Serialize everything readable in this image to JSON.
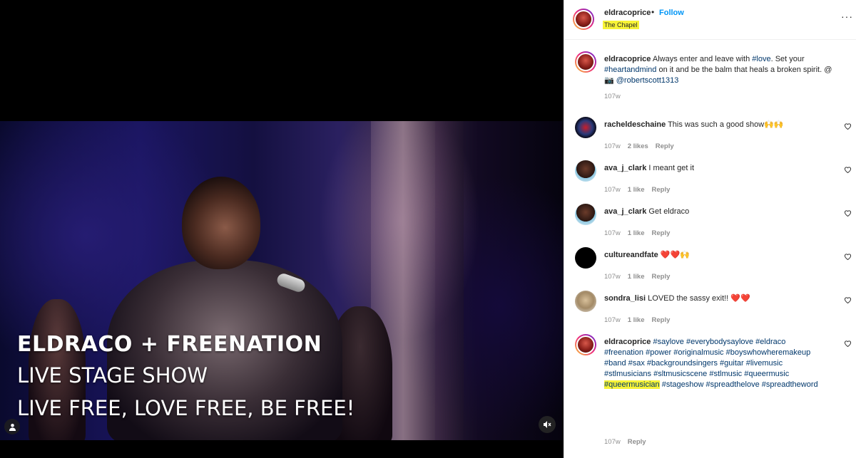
{
  "media": {
    "overlay_lines": [
      "ELDRACO + FREENATION",
      "LIVE STAGE SHOW",
      "LIVE FREE, LOVE FREE, BE FREE!"
    ],
    "user_tag_icon": "person-icon",
    "mute_icon": "muted-speaker-icon"
  },
  "header": {
    "username": "eldracoprice",
    "separator": "•",
    "follow": "Follow",
    "location": "The Chapel",
    "more": "···"
  },
  "caption": {
    "username": "eldracoprice",
    "text_parts": [
      "Always enter and leave with ",
      "#love",
      ". Set your ",
      "#heartandmind",
      " on it and be the balm that heals a broken spirit. @",
      "📷",
      " ",
      "@robertscott1313"
    ],
    "time": "107w"
  },
  "comments": [
    {
      "username": "rachelde schaine",
      "display": "racheldeschaine",
      "text": "This was such a good show🙌🙌",
      "time": "107w",
      "likes": "2 likes",
      "reply": "Reply"
    },
    {
      "display": "ava_j_clark",
      "text": "I meant get it",
      "time": "107w",
      "likes": "1 like",
      "reply": "Reply"
    },
    {
      "display": "ava_j_clark",
      "text": "Get eldraco",
      "time": "107w",
      "likes": "1 like",
      "reply": "Reply"
    },
    {
      "display": "cultureandfate",
      "text": "❤️❤️🙌",
      "time": "107w",
      "likes": "1 like",
      "reply": "Reply"
    },
    {
      "display": "sondra_lisi",
      "text": "LOVED the sassy exit!! ❤️❤️",
      "time": "107w",
      "likes": "1 like",
      "reply": "Reply"
    }
  ],
  "last_comment": {
    "display": "eldracoprice",
    "hashtags_line1": "#saylove #everybodysaylove #eldraco",
    "hashtags_line2": "#freenation #power #originalmusic #boyswhowheremakeup",
    "hashtags_line3": "#band #sax #backgroundsingers #guitar #livemusic",
    "hashtags_line4": "#stlmusicians #sltmusicscene #stlmusic #queermusic",
    "hashtag_highlight": "#queermusician",
    "hashtags_line5_rest": " #stageshow #spreadthelove #spreadtheword",
    "time": "107w",
    "reply": "Reply"
  },
  "icons": {
    "like": "heart-outline-icon"
  },
  "colors": {
    "link": "#00376b",
    "follow": "#0095f6",
    "highlight": "#f7f337",
    "meta": "#8e8e8e"
  }
}
